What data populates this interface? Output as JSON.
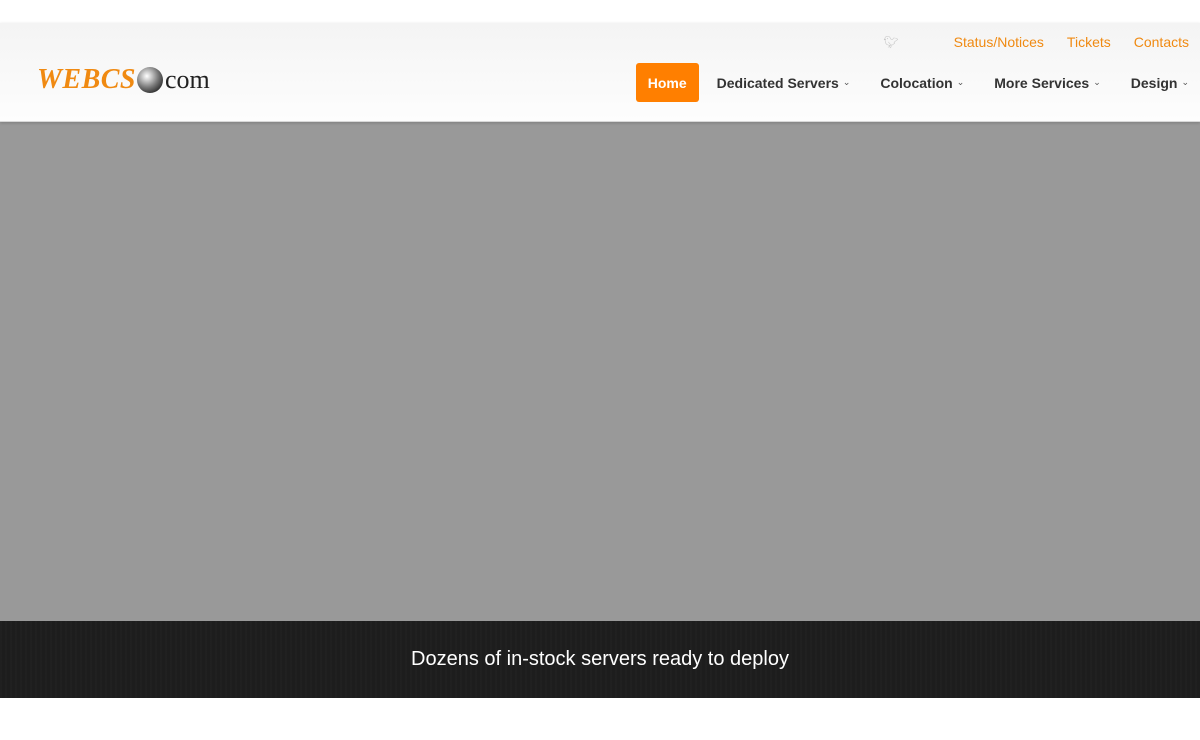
{
  "logo": {
    "brand": "WEBCS",
    "suffix": "com"
  },
  "toplinks": {
    "icon": "twitter-icon",
    "items": [
      {
        "label": "Status/Notices"
      },
      {
        "label": "Tickets"
      },
      {
        "label": "Contacts"
      }
    ]
  },
  "nav": {
    "home": "Home",
    "items": [
      {
        "label": "Dedicated Servers"
      },
      {
        "label": "Colocation"
      },
      {
        "label": "More Services"
      },
      {
        "label": "Design"
      }
    ]
  },
  "band": {
    "text": "Dozens of in-stock servers ready to deploy"
  },
  "colors": {
    "accent": "#ff7f00",
    "link": "#f08a12",
    "hero": "#999999",
    "band": "#1d1d1d"
  }
}
